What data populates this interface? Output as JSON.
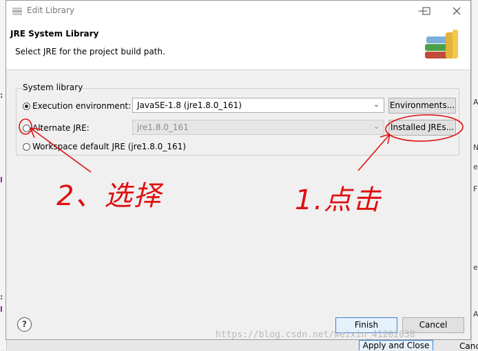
{
  "window": {
    "title": "Edit Library"
  },
  "header": {
    "title": "JRE System Library",
    "subtitle": "Select JRE for the project build path."
  },
  "group": {
    "legend": "System library",
    "options": [
      {
        "label": "Execution environment:",
        "checked": true,
        "combo_value": "JavaSE-1.8 (jre1.8.0_161)",
        "button": "Environments..."
      },
      {
        "label": "Alternate JRE:",
        "checked": false,
        "combo_value": "jre1.8.0_161",
        "button": "Installed JREs..."
      },
      {
        "label": "Workspace default JRE (jre1.8.0_161)",
        "checked": false
      }
    ]
  },
  "footer": {
    "help": "?",
    "finish": "Finish",
    "cancel": "Cancel"
  },
  "annotations": {
    "left": "2、选择",
    "right": "1.点击"
  },
  "watermark": "https://blog.csdn.net/weixin_41202038",
  "behind": {
    "apply_close": "Apply and Close",
    "cancel": "Canc"
  },
  "colors": {
    "annotation_red": "#e01010",
    "default_button_border": "#3c7fd6"
  }
}
